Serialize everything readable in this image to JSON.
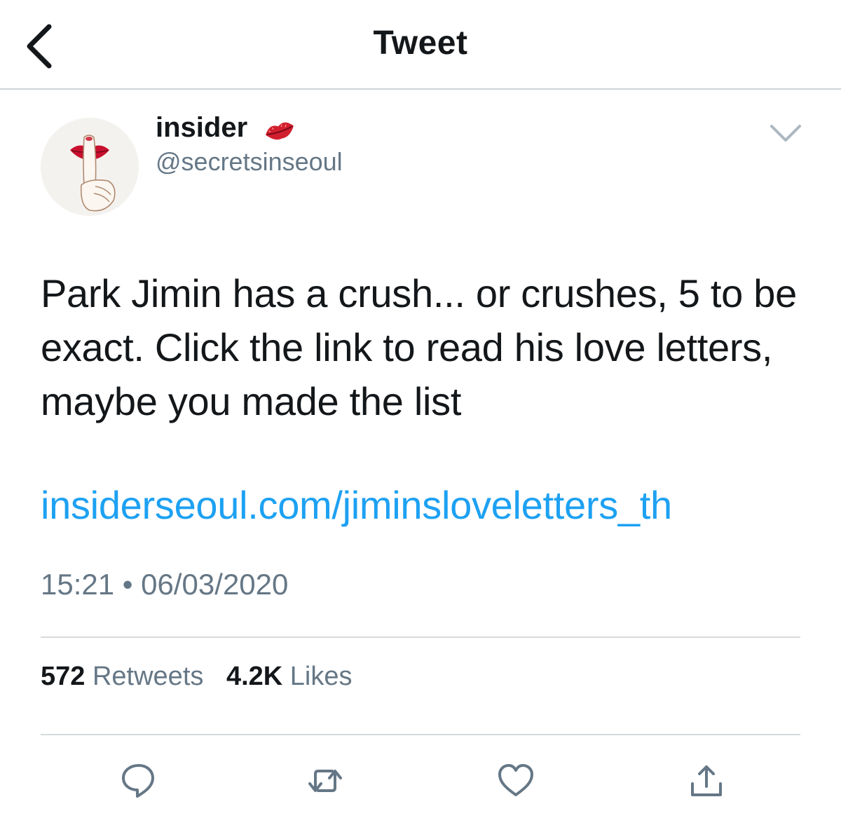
{
  "header": {
    "title": "Tweet",
    "back_icon": "chevron-left-icon"
  },
  "author": {
    "display_name": "insider",
    "badge_icon": "kiss-lips-icon",
    "handle": "@secretsinseoul",
    "avatar_icon": "shush-finger-lips-avatar"
  },
  "tweet": {
    "text": "Park Jimin has a crush... or crushes, 5 to be exact. Click the link to read his love letters, maybe you made the list",
    "link": "insiderseoul.com/jiminsloveletters_th",
    "time": "15:21",
    "separator": "•",
    "date": "06/03/2020"
  },
  "stats": {
    "retweets_count": "572",
    "retweets_label": "Retweets",
    "likes_count": "4.2K",
    "likes_label": "Likes"
  },
  "actions": {
    "reply_icon": "reply-icon",
    "retweet_icon": "retweet-icon",
    "like_icon": "heart-icon",
    "share_icon": "share-icon"
  },
  "colors": {
    "link": "#1da1f2",
    "secondary_text": "#657786",
    "primary_text": "#14171a",
    "divider": "#d6dadd",
    "lips_red": "#c8102e"
  }
}
